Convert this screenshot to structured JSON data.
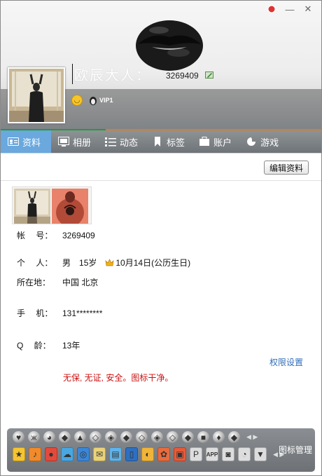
{
  "window": {
    "pin_icon": "pin-icon",
    "minimize_label": "—",
    "close_label": "✕"
  },
  "profile": {
    "nickname": "欧辰大人：",
    "qq_number": "3269409",
    "vip_label": "VIP1"
  },
  "tabs": [
    {
      "label": "资料",
      "icon": "profile-card-icon",
      "active": true
    },
    {
      "label": "相册",
      "icon": "album-icon",
      "active": false
    },
    {
      "label": "动态",
      "icon": "feed-list-icon",
      "active": false
    },
    {
      "label": "标签",
      "icon": "bookmark-tag-icon",
      "active": false
    },
    {
      "label": "账户",
      "icon": "wallet-icon",
      "active": false
    },
    {
      "label": "游戏",
      "icon": "game-icon",
      "active": false
    }
  ],
  "content": {
    "edit_button": "编辑资料",
    "rows": {
      "account": {
        "label": "帐　 号：",
        "value": "3269409"
      },
      "personal": {
        "label": "个　 人：",
        "gender": "男",
        "age": "15岁",
        "birthday": "10月14日(公历生日)"
      },
      "location": {
        "label": "所在地：",
        "value": "中国 北京"
      },
      "phone": {
        "label": "手　 机：",
        "value": "131********"
      },
      "qage": {
        "label": "Q　 龄：",
        "value": "13年"
      }
    },
    "permission_link": "权限设置",
    "signature": "无保, 无证, 安全。图标干净。"
  },
  "iconbar": {
    "manage_label": "图标管理",
    "row1": [
      "heart-icon",
      "butterfly-icon",
      "penguin-icon",
      "diamond-icon",
      "qq-penguin-icon",
      "gem-icon",
      "crystal-icon",
      "gem-level-icon",
      "gem-star-icon",
      "chat-gem-icon",
      "diamond-outline-icon",
      "diamond-small-icon",
      "lock-icon",
      "diamond-heart-icon",
      "black-diamond-icon"
    ],
    "row2": [
      "star-icon",
      "music-icon",
      "qq-show-icon",
      "cloud-icon",
      "globe-icon",
      "mail-icon",
      "blog-icon",
      "phone-icon",
      "space-icon",
      "pet-icon",
      "pad-icon",
      "p-icon",
      "app-icon",
      "camera-icon",
      "chat-bubble-icon",
      "shield-icon"
    ]
  },
  "colors": {
    "tab_active": "#6aa8de",
    "signature_red": "#cc1010",
    "link_blue": "#2f6db8"
  }
}
